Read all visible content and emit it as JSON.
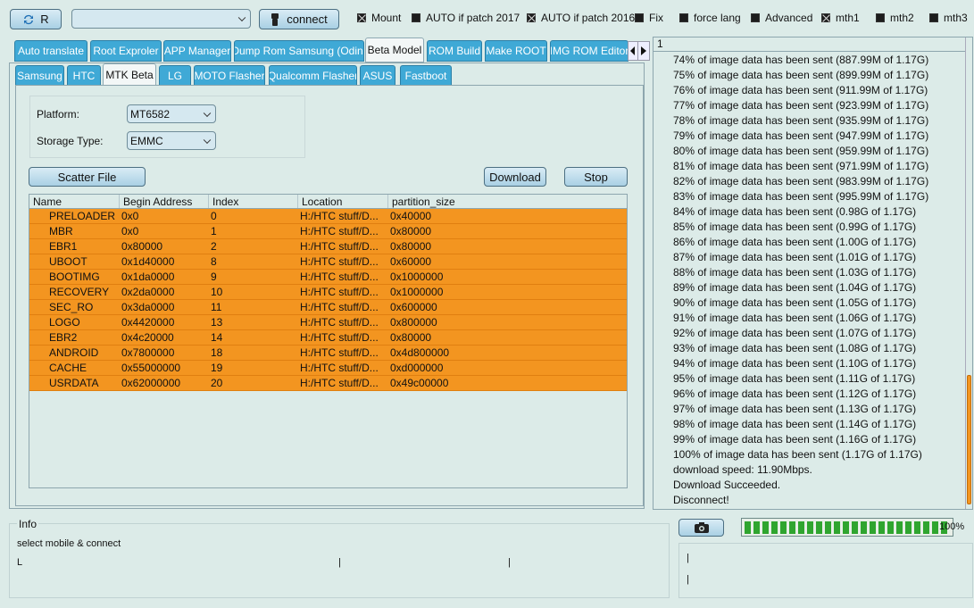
{
  "toolbar": {
    "refresh_label": "R",
    "device_combo_value": "",
    "connect_label": "connect",
    "checks": [
      {
        "label": "Mount",
        "checked": true
      },
      {
        "label": "AUTO if patch 2017",
        "checked": false
      },
      {
        "label": "AUTO if patch 2016",
        "checked": true
      },
      {
        "label": "Fix",
        "checked": false
      },
      {
        "label": "force lang",
        "checked": false
      },
      {
        "label": "Advanced",
        "checked": false
      },
      {
        "label": "mth1",
        "checked": true
      },
      {
        "label": "mth2",
        "checked": false
      },
      {
        "label": "mth3",
        "checked": false
      }
    ]
  },
  "main_tabs": [
    "Auto translate",
    "Root Exproler",
    "APP Manager",
    "Dump Rom Samsung (Odin)",
    "Beta Model",
    "ROM Build",
    "Make ROOT",
    "IMG ROM Editor"
  ],
  "sub_tabs": [
    "Samsung",
    "HTC",
    "MTK Beta",
    "LG",
    "MOTO Flasher",
    "Qualcomm Flasher",
    "ASUS",
    "Fastboot"
  ],
  "mtk": {
    "platform_label": "Platform:",
    "platform_value": "MT6582",
    "storage_label": "Storage Type:",
    "storage_value": "EMMC",
    "scatter_label": "Scatter File",
    "download_label": "Download",
    "stop_label": "Stop",
    "columns": [
      "Name",
      "Begin Address",
      "Index",
      "Location",
      "partition_size"
    ],
    "rows": [
      [
        "PRELOADER",
        "0x0",
        "0",
        "H:/HTC stuff/D...",
        "0x40000"
      ],
      [
        "MBR",
        "0x0",
        "1",
        "H:/HTC stuff/D...",
        "0x80000"
      ],
      [
        "EBR1",
        "0x80000",
        "2",
        "H:/HTC stuff/D...",
        "0x80000"
      ],
      [
        "UBOOT",
        "0x1d40000",
        "8",
        "H:/HTC stuff/D...",
        "0x60000"
      ],
      [
        "BOOTIMG",
        "0x1da0000",
        "9",
        "H:/HTC stuff/D...",
        "0x1000000"
      ],
      [
        "RECOVERY",
        "0x2da0000",
        "10",
        "H:/HTC stuff/D...",
        "0x1000000"
      ],
      [
        "SEC_RO",
        "0x3da0000",
        "11",
        "H:/HTC stuff/D...",
        "0x600000"
      ],
      [
        "LOGO",
        "0x4420000",
        "13",
        "H:/HTC stuff/D...",
        "0x800000"
      ],
      [
        "EBR2",
        "0x4c20000",
        "14",
        "H:/HTC stuff/D...",
        "0x80000"
      ],
      [
        "ANDROID",
        "0x7800000",
        "18",
        "H:/HTC stuff/D...",
        "0x4d800000"
      ],
      [
        "CACHE",
        "0x55000000",
        "19",
        "H:/HTC stuff/D...",
        "0xd000000"
      ],
      [
        "USRDATA",
        "0x62000000",
        "20",
        "H:/HTC stuff/D...",
        "0x49c00000"
      ]
    ]
  },
  "log": {
    "header": "1",
    "lines": [
      "74% of image data has been sent (887.99M of 1.17G)",
      "75% of image data has been sent (899.99M of 1.17G)",
      "76% of image data has been sent (911.99M of 1.17G)",
      "77% of image data has been sent (923.99M of 1.17G)",
      "78% of image data has been sent (935.99M of 1.17G)",
      "79% of image data has been sent (947.99M of 1.17G)",
      "80% of image data has been sent (959.99M of 1.17G)",
      "81% of image data has been sent (971.99M of 1.17G)",
      "82% of image data has been sent (983.99M of 1.17G)",
      "83% of image data has been sent (995.99M of 1.17G)",
      "84% of image data has been sent (0.98G of 1.17G)",
      "85% of image data has been sent (0.99G of 1.17G)",
      "86% of image data has been sent (1.00G of 1.17G)",
      "87% of image data has been sent (1.01G of 1.17G)",
      "88% of image data has been sent (1.03G of 1.17G)",
      "89% of image data has been sent (1.04G of 1.17G)",
      "90% of image data has been sent (1.05G of 1.17G)",
      "91% of image data has been sent (1.06G of 1.17G)",
      "92% of image data has been sent (1.07G of 1.17G)",
      "93% of image data has been sent (1.08G of 1.17G)",
      "94% of image data has been sent (1.10G of 1.17G)",
      "95% of image data has been sent (1.11G of 1.17G)",
      "96% of image data has been sent (1.12G of 1.17G)",
      "97% of image data has been sent (1.13G of 1.17G)",
      "98% of image data has been sent (1.14G of 1.17G)",
      "99% of image data has been sent (1.16G of 1.17G)",
      "100% of image data has been sent (1.17G of 1.17G)",
      "download speed: 11.90Mbps.",
      "Download Succeeded.",
      "Disconnect!"
    ]
  },
  "info": {
    "title": "Info",
    "message": "select mobile & connect",
    "status_marks": [
      "L",
      "|",
      "|"
    ]
  },
  "status_right": {
    "progress_percent": 100,
    "progress_label": "100%",
    "marks": [
      "|",
      "|"
    ]
  },
  "colors": {
    "background": "#dcebe8",
    "tab_blue": "#3fa9d6",
    "row_orange": "#f39520",
    "progress_green": "#2fa52f"
  },
  "icons": {
    "refresh": "refresh-icon",
    "usb": "usb-icon",
    "camera": "camera-icon"
  }
}
